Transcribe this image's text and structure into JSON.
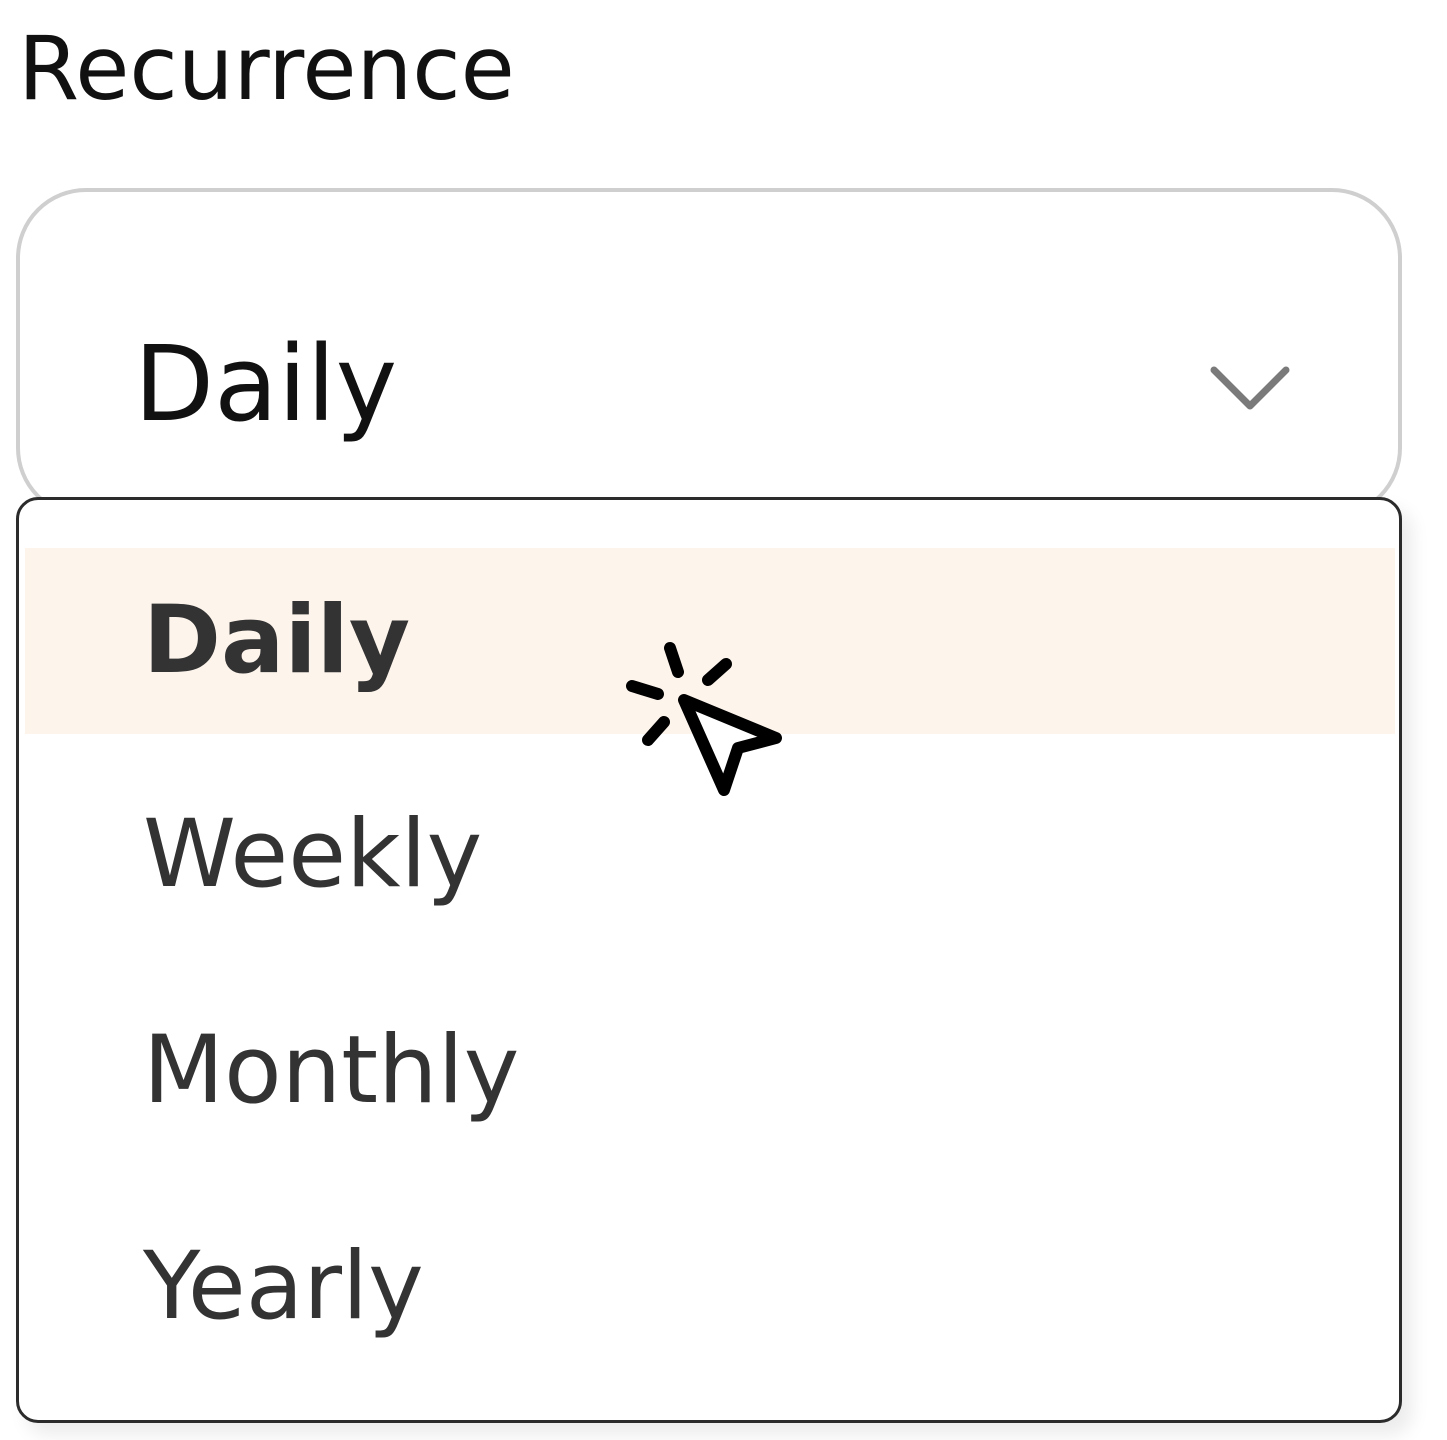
{
  "field": {
    "label": "Recurrence"
  },
  "select": {
    "value": "Daily",
    "chevron_icon": "chevron-down-icon"
  },
  "dropdown": {
    "options": [
      {
        "label": "Daily",
        "selected": true
      },
      {
        "label": "Weekly",
        "selected": false
      },
      {
        "label": "Monthly",
        "selected": false
      },
      {
        "label": "Yearly",
        "selected": false
      }
    ]
  },
  "colors": {
    "selected_bg": "#fdf4ec",
    "border": "#cfcfcf",
    "menu_border": "#2b2b2b",
    "text": "#333333"
  },
  "cursor_icon": "pointer-click-icon"
}
